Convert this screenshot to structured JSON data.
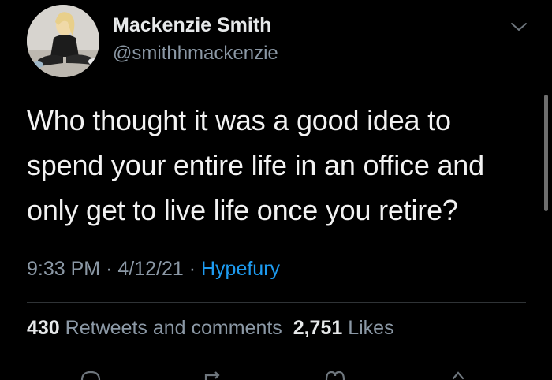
{
  "user": {
    "display_name": "Mackenzie Smith",
    "handle": "@smithhmackenzie"
  },
  "tweet": {
    "text_lines": [
      "Who thought it was a good idea to",
      "spend your entire life in an office and",
      "only get to live life once you retire?"
    ],
    "time": "9:33 PM",
    "separator": "·",
    "date": "4/12/21",
    "source": "Hypefury"
  },
  "stats": {
    "retweets_count": "430",
    "retweets_label": "Retweets and comments",
    "likes_count": "2,751",
    "likes_label": "Likes"
  },
  "icons": {
    "more": "chevron-down-icon",
    "reply": "reply-icon",
    "retweet": "retweet-icon",
    "like": "heart-icon",
    "share": "share-icon"
  },
  "colors": {
    "background": "#000000",
    "primary_text": "#e7e9ea",
    "secondary_text": "#8b98a5",
    "link": "#1d9bf0",
    "divider": "#2f3336"
  }
}
